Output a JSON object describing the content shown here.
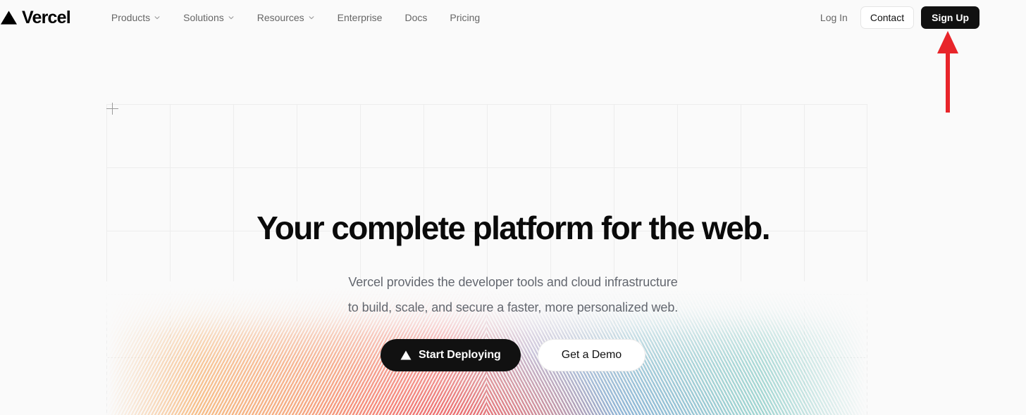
{
  "brand": {
    "name": "Vercel",
    "logo_icon": "vercel-triangle-icon"
  },
  "header": {
    "nav_items": [
      {
        "label": "Products",
        "has_dropdown": true,
        "icon": "chevron-down-icon"
      },
      {
        "label": "Solutions",
        "has_dropdown": true,
        "icon": "chevron-down-icon"
      },
      {
        "label": "Resources",
        "has_dropdown": true,
        "icon": "chevron-down-icon"
      },
      {
        "label": "Enterprise",
        "has_dropdown": false
      },
      {
        "label": "Docs",
        "has_dropdown": false
      },
      {
        "label": "Pricing",
        "has_dropdown": false
      }
    ],
    "login_label": "Log In",
    "contact_label": "Contact",
    "signup_label": "Sign Up"
  },
  "hero": {
    "headline": "Your complete platform for the web.",
    "subline_line1": "Vercel provides the developer tools and cloud infrastructure",
    "subline_line2": "to build, scale, and secure a faster, more personalized web.",
    "primary_cta": "Start Deploying",
    "primary_cta_icon": "vercel-triangle-icon",
    "secondary_cta": "Get a Demo"
  },
  "annotation": {
    "type": "arrow",
    "points_to": "signup-button",
    "color": "#e8252a"
  },
  "colors": {
    "page_background": "#fafafa",
    "text_primary": "#111111",
    "text_muted": "#666666",
    "subline_text": "#63676f",
    "button_dark": "#111111",
    "button_light": "#ffffff",
    "border_light": "#e5e5e5",
    "grid_line": "#ededed",
    "annotation_red": "#e8252a",
    "gradient_left": "#f6ad68",
    "gradient_center": "#f45a5a",
    "gradient_right": "#8ccdc8"
  }
}
